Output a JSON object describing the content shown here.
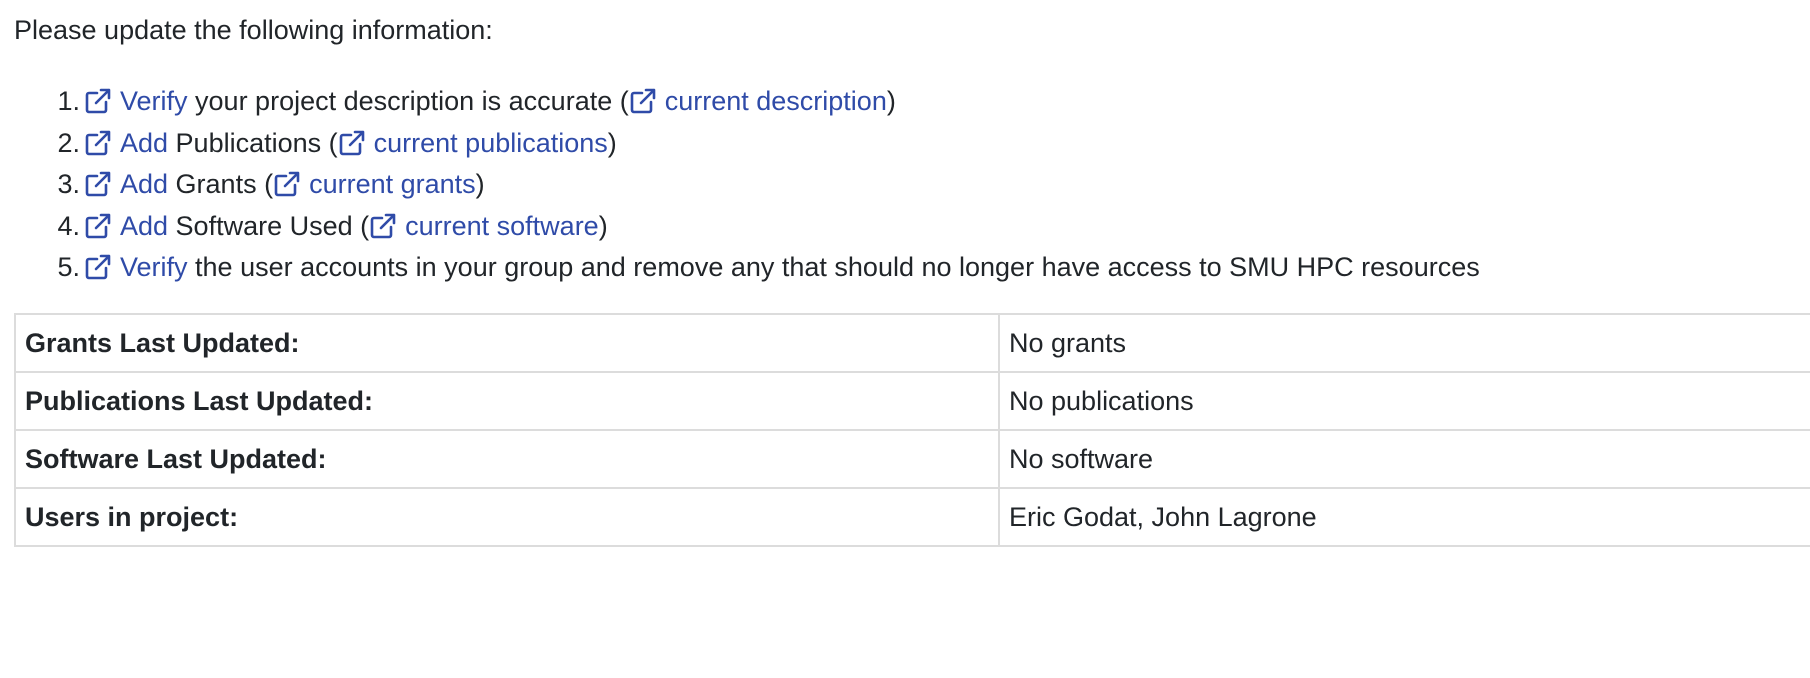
{
  "intro": "Please update the following information:",
  "colors": {
    "link": "#2f4ba8",
    "text": "#212529",
    "border": "#dcdcdc"
  },
  "icons": {
    "link_icon": "external-link-icon"
  },
  "tasks": [
    {
      "num": "1.",
      "link": "Verify",
      "text_before_paren": " your project description is accurate (",
      "link2": "current description",
      "text_after": ")"
    },
    {
      "num": "2.",
      "link": "Add",
      "text_before_paren": " Publications (",
      "link2": "current publications",
      "text_after": ")"
    },
    {
      "num": "3.",
      "link": "Add",
      "text_before_paren": " Grants (",
      "link2": "current grants",
      "text_after": ")"
    },
    {
      "num": "4.",
      "link": "Add",
      "text_before_paren": " Software Used (",
      "link2": "current software",
      "text_after": ")"
    },
    {
      "num": "5.",
      "link": "Verify",
      "text": " the user accounts in your group and remove any that should no longer have access to SMU HPC resources"
    }
  ],
  "table": [
    {
      "label": "Grants Last Updated:",
      "value": "No grants"
    },
    {
      "label": "Publications Last Updated:",
      "value": "No publications"
    },
    {
      "label": "Software Last Updated:",
      "value": "No software"
    },
    {
      "label": "Users in project:",
      "value": "Eric Godat, John Lagrone"
    }
  ]
}
